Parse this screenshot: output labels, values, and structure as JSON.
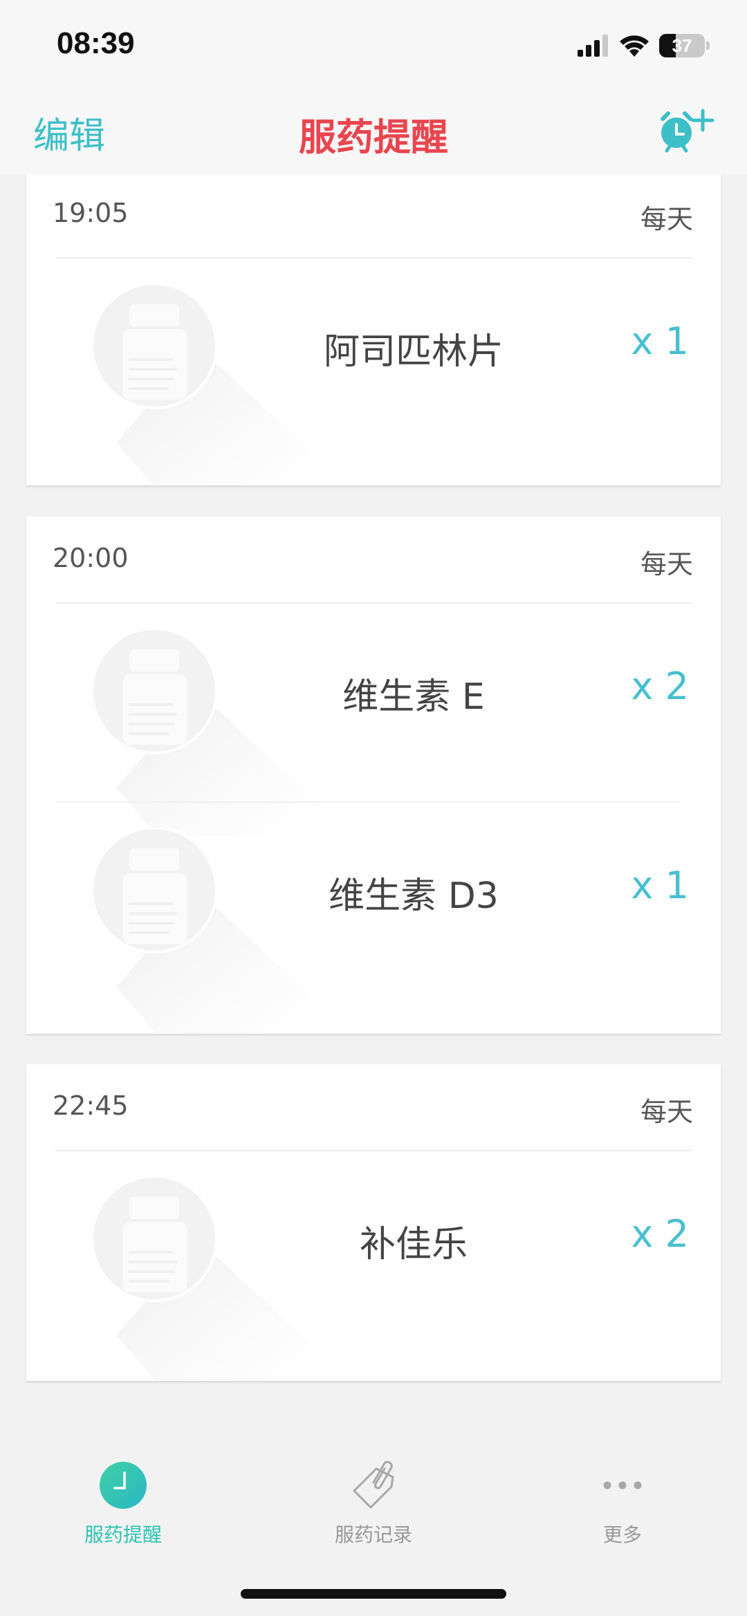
{
  "status_bar": {
    "time": "08:39",
    "battery_level": "37"
  },
  "nav": {
    "edit_label": "编辑",
    "title": "服药提醒",
    "add_icon": "alarm-plus-icon",
    "accent_color": "#3cbfc8",
    "title_color": "#e8464f"
  },
  "reminders": [
    {
      "time": "19:05",
      "repeat": "每天",
      "meds": [
        {
          "name": "阿司匹林片",
          "qty": "x 1"
        }
      ]
    },
    {
      "time": "20:00",
      "repeat": "每天",
      "meds": [
        {
          "name": "维生素 E",
          "qty": "x 2"
        },
        {
          "name": "维生素 D3",
          "qty": "x 1"
        }
      ]
    },
    {
      "time": "22:45",
      "repeat": "每天",
      "meds": [
        {
          "name": "补佳乐",
          "qty": "x 2"
        }
      ]
    }
  ],
  "tabs": [
    {
      "label": "服药提醒",
      "icon": "clock-icon",
      "active": true
    },
    {
      "label": "服药记录",
      "icon": "paperclip-tag-icon",
      "active": false
    },
    {
      "label": "更多",
      "icon": "more-dots-icon",
      "active": false
    }
  ]
}
